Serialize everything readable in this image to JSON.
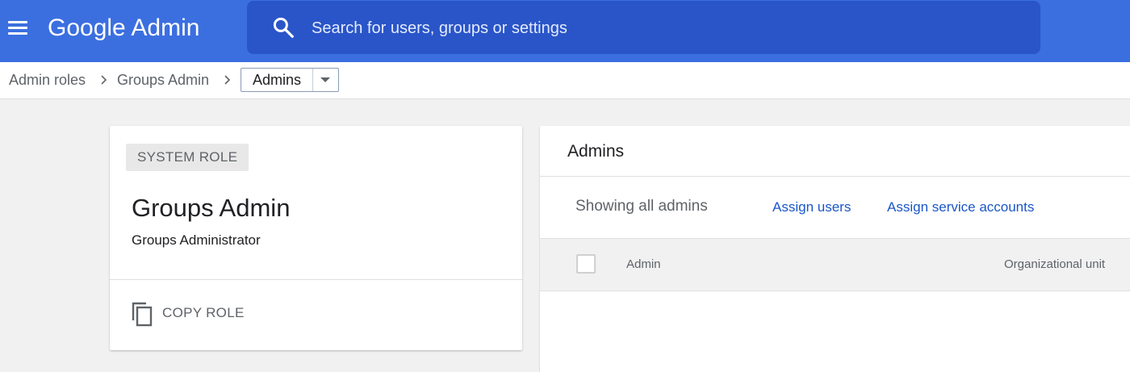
{
  "header": {
    "app_title": "Google Admin",
    "search_placeholder": "Search for users, groups or settings",
    "search_value": "",
    "accent_color": "#3b6fe0"
  },
  "breadcrumb": {
    "items": [
      "Admin roles",
      "Groups Admin"
    ],
    "current": "Admins"
  },
  "role_card": {
    "badge": "SYSTEM ROLE",
    "title": "Groups Admin",
    "subtitle": "Groups Administrator",
    "copy_label": "COPY ROLE",
    "copy_icon": "copy-icon"
  },
  "admins_panel": {
    "title": "Admins",
    "filter_text": "Showing all admins",
    "assign_users": "Assign users",
    "assign_service_accounts": "Assign service accounts",
    "link_color": "#1a56c8",
    "columns": [
      "Admin",
      "Organizational unit"
    ]
  }
}
